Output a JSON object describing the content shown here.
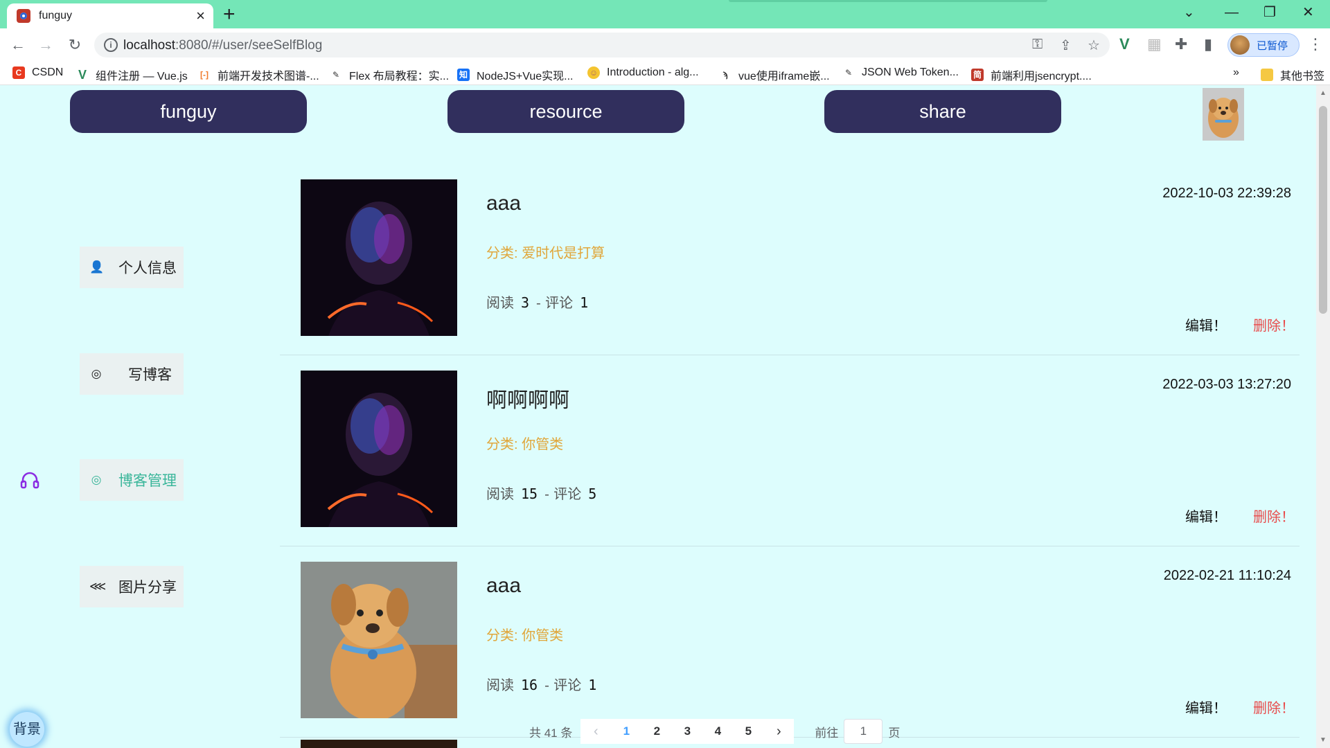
{
  "browser": {
    "tab_title": "funguy",
    "url_host": "localhost",
    "url_rest": ":8080/#/user/seeSelfBlog",
    "profile_label": "已暂停",
    "bookmarks": [
      "CSDN",
      "组件注册 — Vue.js",
      "前端开发技术图谱-...",
      "Flex 布局教程：实...",
      "NodeJS+Vue实现...",
      "Introduction - alg...",
      "vue使用iframe嵌...",
      "JSON Web Token...",
      "前端利用jsencrypt...."
    ],
    "bookmarks_more": "»",
    "other_bookmarks": "其他书签"
  },
  "header": {
    "nav": [
      "funguy",
      "resource",
      "share"
    ]
  },
  "sidebar": {
    "items": [
      {
        "label": "个人信息",
        "icon": "user-icon",
        "active": false
      },
      {
        "label": "写博客",
        "icon": "edit-circle-icon",
        "active": false
      },
      {
        "label": "博客管理",
        "icon": "manage-circle-icon",
        "active": true
      },
      {
        "label": "图片分享",
        "icon": "share-icon",
        "active": false
      }
    ]
  },
  "floating": {
    "bg_label": "背景"
  },
  "posts": [
    {
      "title": "aaa",
      "category": "分类: 爱时代是打算",
      "read_label": "阅读",
      "reads": "3",
      "sep": "-",
      "comment_label": "评论",
      "comments": "1",
      "date": "2022-10-03 22:39:28",
      "edit": "编辑！",
      "delete": "删除！",
      "thumb": "portrait"
    },
    {
      "title": "啊啊啊啊",
      "category": "分类: 你管类",
      "read_label": "阅读",
      "reads": "15",
      "sep": "-",
      "comment_label": "评论",
      "comments": "5",
      "date": "2022-03-03 13:27:20",
      "edit": "编辑！",
      "delete": "删除！",
      "thumb": "portrait"
    },
    {
      "title": "aaa",
      "category": "分类: 你管类",
      "read_label": "阅读",
      "reads": "16",
      "sep": "-",
      "comment_label": "评论",
      "comments": "1",
      "date": "2022-02-21 11:10:24",
      "edit": "编辑！",
      "delete": "删除！",
      "thumb": "dog"
    }
  ],
  "pagination": {
    "total": "共 41 条",
    "pages": [
      "1",
      "2",
      "3",
      "4",
      "5"
    ],
    "current": "1",
    "goto_label": "前往",
    "goto_value": "1",
    "page_suffix": "页"
  },
  "colors": {
    "page_bg": "#ddfdfd",
    "nav_pill": "#312f5d",
    "category": "#e0a63a",
    "delete": "#e84b4b",
    "active_side": "#3ab69a",
    "tabstrip": "#74e6b7"
  }
}
